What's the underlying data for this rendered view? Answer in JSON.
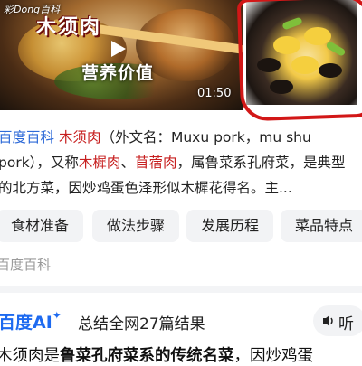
{
  "hero": {
    "watermark": "彩Dong百科",
    "video_title": "木须肉",
    "play_label": "营养价值",
    "duration": "01:50"
  },
  "description": {
    "source_label": "百度百科",
    "name": "木须肉",
    "part1": "（外文名：Muxu pork，mu shu pork），又称",
    "alias1": "木樨肉",
    "sep": "、",
    "alias2": "苜蓿肉",
    "part2": "，属鲁菜系孔府菜，是典型的北方菜，因炒鸡蛋色泽形似木樨花得名。主..."
  },
  "tags": [
    "食材准备",
    "做法步骤",
    "发展历程",
    "菜品特点"
  ],
  "source_footer": "百度百科",
  "ai": {
    "logo": "百度AI",
    "logo_star": "✦",
    "summary": "总结全网27篇结果",
    "listen_label": "听",
    "answer_plain": "木须肉是",
    "answer_bold": "鲁菜孔府菜系的传统名菜",
    "answer_rest": "，因炒鸡蛋"
  },
  "colors": {
    "link_red": "#c71f1f",
    "brand_blue": "#2f6bd8",
    "annotation_red": "#d21717"
  }
}
